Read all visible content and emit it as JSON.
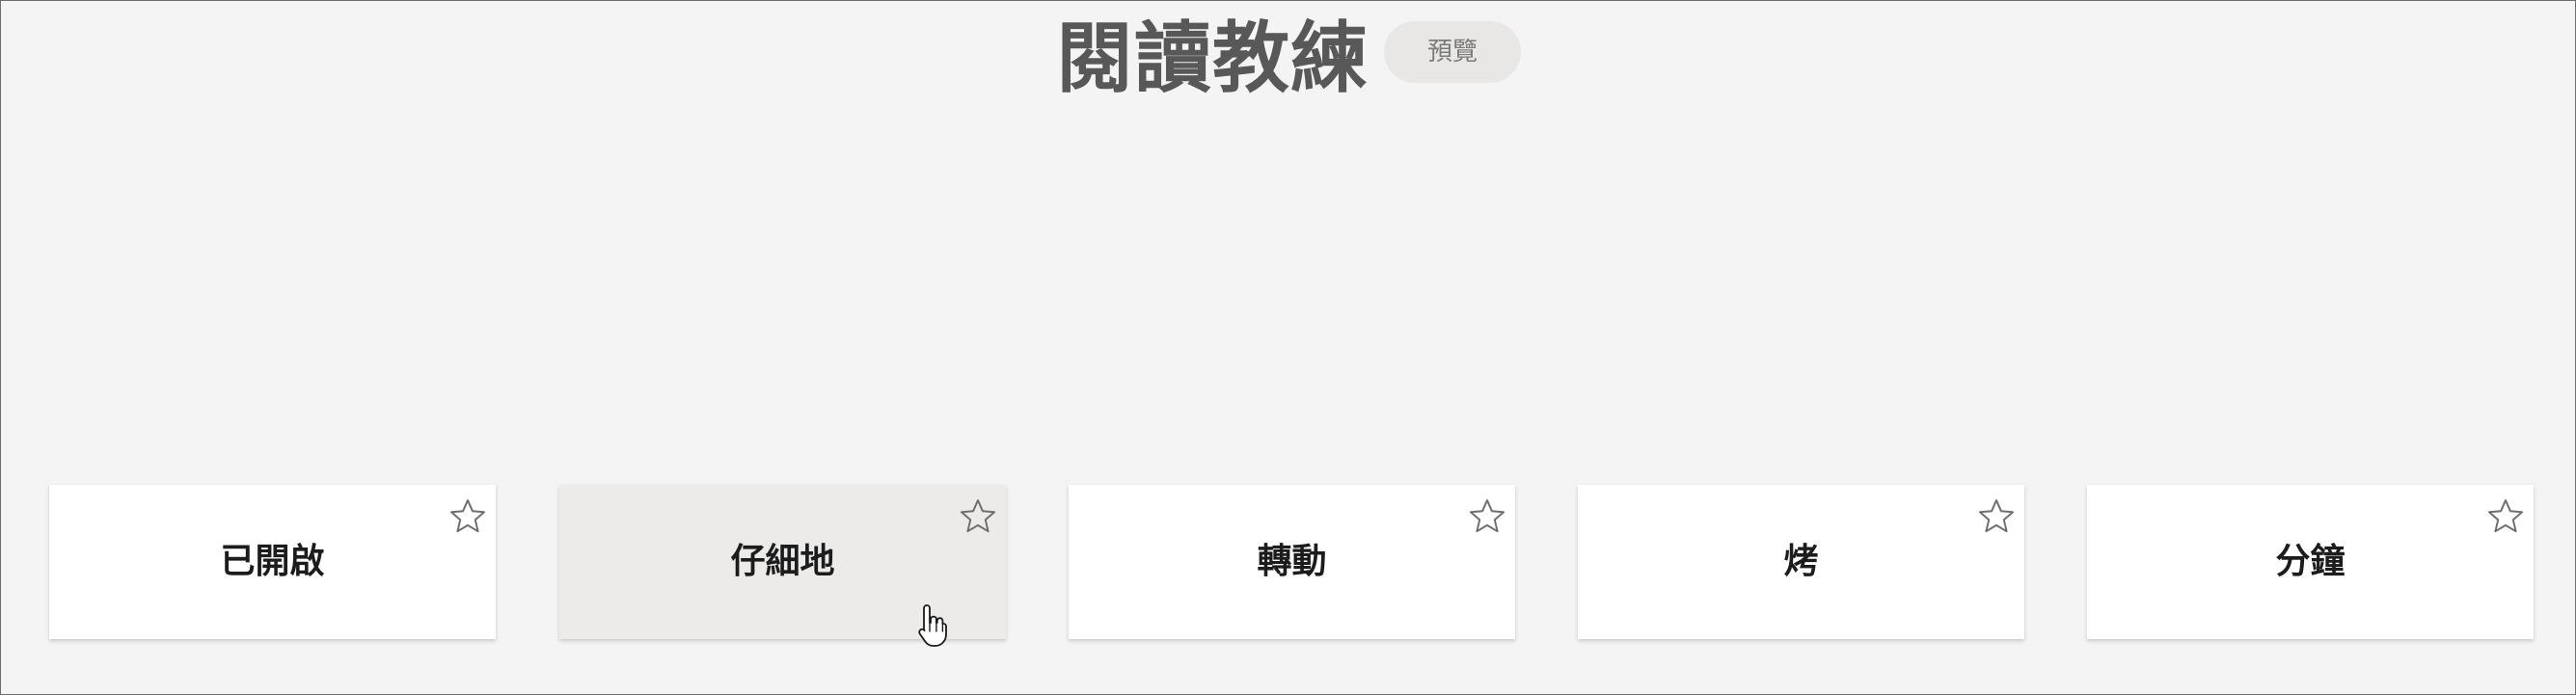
{
  "header": {
    "title": "閱讀教練",
    "badge": "預覽"
  },
  "cards": [
    {
      "word": "已開啟",
      "favorite": false,
      "hovered": false
    },
    {
      "word": "仔細地",
      "favorite": false,
      "hovered": true
    },
    {
      "word": "轉動",
      "favorite": false,
      "hovered": false
    },
    {
      "word": "烤",
      "favorite": false,
      "hovered": false
    },
    {
      "word": "分鐘",
      "favorite": false,
      "hovered": false
    }
  ],
  "icons": {
    "favorite": "star-outline-icon",
    "pointer": "hand-pointer-icon"
  },
  "colors": {
    "background": "#f4f4f4",
    "card": "#ffffff",
    "card_hover": "#ecebea",
    "title": "#585858",
    "badge_bg": "#e8e7e5",
    "badge_text": "#7b7b7b"
  }
}
